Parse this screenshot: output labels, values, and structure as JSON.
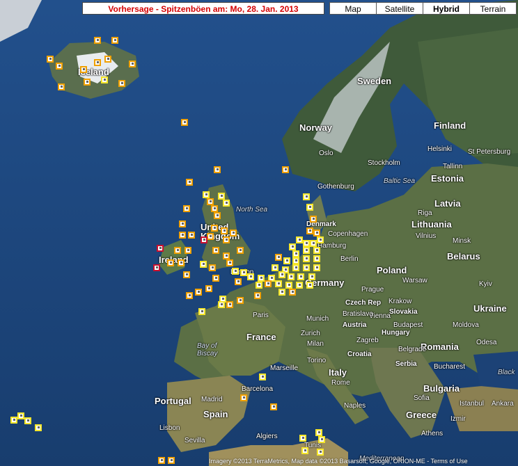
{
  "header": {
    "title": "Vorhersage - Spitzenböen am: Mo, 28. Jan. 2013"
  },
  "map_types": [
    {
      "label": "Map",
      "active": false
    },
    {
      "label": "Satellite",
      "active": false
    },
    {
      "label": "Hybrid",
      "active": true
    },
    {
      "label": "Terrain",
      "active": false
    }
  ],
  "labels": {
    "countries": [
      "Sweden",
      "Norway",
      "Finland",
      "Estonia",
      "Latvia",
      "Lithuania",
      "Belarus",
      "Poland",
      "Germany",
      "United Kingdom",
      "Ireland",
      "France",
      "Ukraine",
      "Moldova",
      "Romania",
      "Hungary",
      "Slovakia",
      "Czech Rep",
      "Austria",
      "Croatia",
      "Serbia",
      "Bulgaria",
      "Italy",
      "Spain",
      "Portugal",
      "Greece",
      "Denmark",
      "Iceland"
    ],
    "cities": [
      "Oslo",
      "Stockholm",
      "Helsinki",
      "St Petersburg",
      "Tallinn",
      "Riga",
      "Vilnius",
      "Minsk",
      "Warsaw",
      "Kyiv",
      "Berlin",
      "Hamburg",
      "Prague",
      "Krakow",
      "Vienna",
      "Bratislava",
      "Munich",
      "Budapest",
      "Zagreb",
      "Belgrade",
      "Bucharest",
      "Sofia",
      "Odesa",
      "Zurich",
      "Milan",
      "Torino",
      "Rome",
      "Naples",
      "Marseille",
      "Barcelona",
      "Madrid",
      "Lisbon",
      "Sevilla",
      "Algiers",
      "Tunis",
      "Istanbul",
      "Ankara",
      "Izmir",
      "Athens",
      "London",
      "Paris",
      "Gothenburg",
      "Copenhagen"
    ],
    "seas": [
      "North Sea",
      "Baltic Sea",
      "Bay of Biscay",
      "Mediterranean",
      "Black"
    ]
  },
  "footer": {
    "attribution": "Imagery ©2013 TerraMetrics, Map data ©2013 Basarsoft, Google, ORION-ME - Terms of Use"
  }
}
